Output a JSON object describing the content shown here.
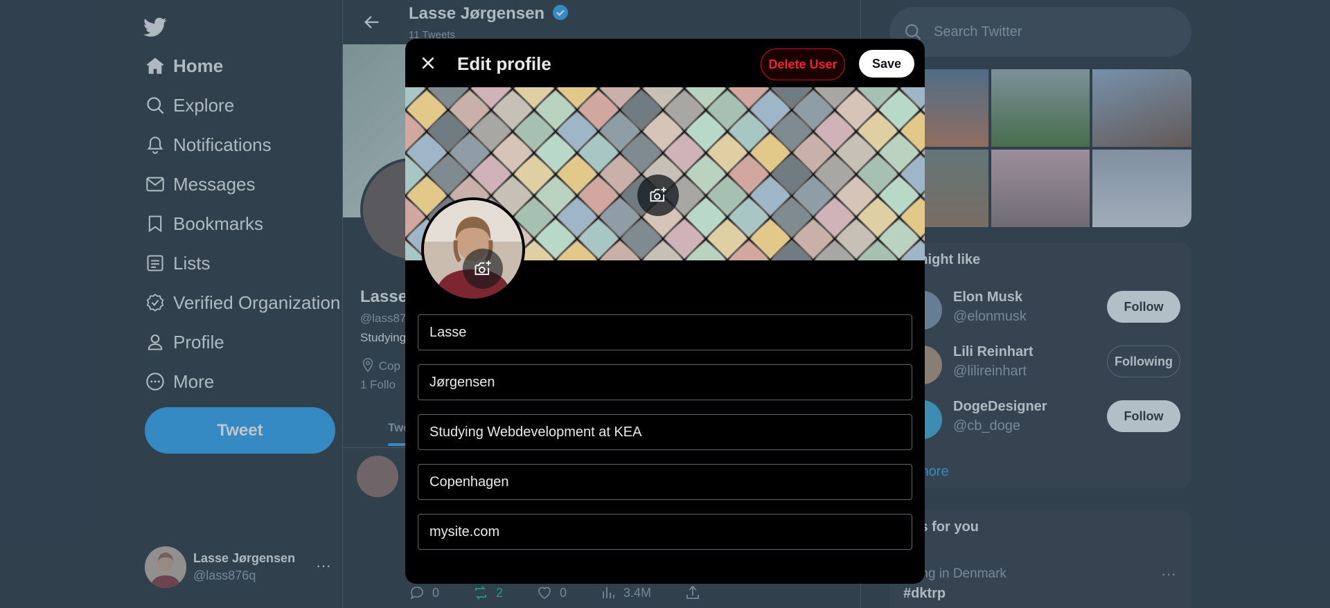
{
  "nav": {
    "items": [
      {
        "label": "Home",
        "icon": "home-icon"
      },
      {
        "label": "Explore",
        "icon": "search-icon"
      },
      {
        "label": "Notifications",
        "icon": "bell-icon"
      },
      {
        "label": "Messages",
        "icon": "mail-icon"
      },
      {
        "label": "Bookmarks",
        "icon": "bookmark-icon"
      },
      {
        "label": "Lists",
        "icon": "list-icon"
      },
      {
        "label": "Verified Organization",
        "icon": "verified-icon"
      },
      {
        "label": "Profile",
        "icon": "person-icon"
      },
      {
        "label": "More",
        "icon": "more-circle-icon"
      }
    ],
    "tweet_button": "Tweet"
  },
  "account": {
    "name": "Lasse Jørgensen",
    "handle": "@lass876q",
    "more": "···"
  },
  "profile_page": {
    "title": "Lasse Jørgensen",
    "tweet_count": "11 Tweets",
    "name_partial": "Lasse",
    "handle_partial": "@lass87",
    "bio_partial": "Studying",
    "location_partial": "Cop",
    "follow_partial": "1  Follo",
    "tab_partial": "Twe",
    "tweet_actions": {
      "replies": "0",
      "retweets": "2",
      "likes": "0",
      "views": "3.4M"
    }
  },
  "sidebar": {
    "search_placeholder": "Search Twitter",
    "who_title": "u might like",
    "suggestions": [
      {
        "name": "Elon Musk",
        "handle": "@elonmusk",
        "button": "Follow"
      },
      {
        "name": "Lili Reinhart",
        "handle": "@lilireinhart",
        "button": "Following"
      },
      {
        "name": "DogeDesigner",
        "handle": "@cb_doge",
        "button": "Follow"
      }
    ],
    "show_more": "w more",
    "trends_title": "nds for you",
    "trend_meta": "nding in Denmark",
    "trend_name": "#dktrp",
    "trend_more": "···"
  },
  "modal": {
    "title": "Edit profile",
    "delete_label": "Delete User",
    "save_label": "Save",
    "fields": {
      "first_name": "Lasse",
      "last_name": "Jørgensen",
      "bio": "Studying Webdevelopment at KEA",
      "location": "Copenhagen",
      "website": "mysite.com"
    }
  },
  "colors": {
    "background": "#15202b",
    "accent": "#1d9bf0",
    "delete": "#f4212e",
    "modal": "#000000",
    "retweet_green": "#00ba7c"
  }
}
